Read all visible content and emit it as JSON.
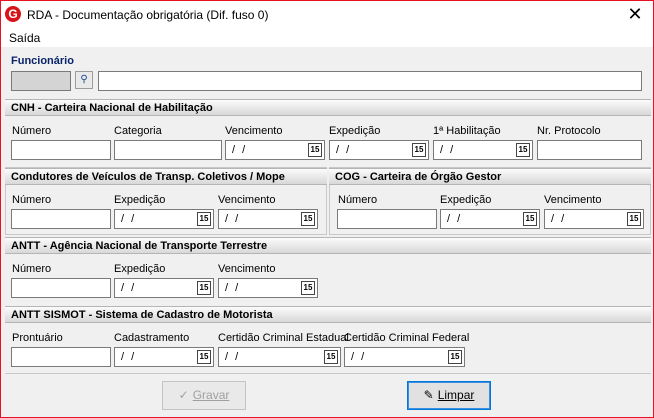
{
  "window": {
    "title": "RDA - Documentação obrigatória (Dif. fuso 0)",
    "app_icon": "G",
    "close": "✕"
  },
  "menu": {
    "items": [
      "Saída"
    ]
  },
  "funcionario": {
    "label": "Funcionário",
    "lookup_icon": "binoculars-icon"
  },
  "cnh": {
    "title": "CNH - Carteira Nacional de Habilitação",
    "labels": [
      "Número",
      "Categoria",
      "Vencimento",
      "Expedição",
      "1ª Habilitação",
      "Nr. Protocolo"
    ],
    "date_placeholder": "/ /"
  },
  "condutores": {
    "title": "Condutores de Veículos de Transp. Coletivos / Mope",
    "labels": [
      "Número",
      "Expedição",
      "Vencimento"
    ]
  },
  "cog": {
    "title": "COG - Carteira de Órgão Gestor",
    "labels": [
      "Número",
      "Expedição",
      "Vencimento"
    ]
  },
  "antt": {
    "title": "ANTT - Agência Nacional de Transporte Terrestre",
    "labels": [
      "Número",
      "Expedição",
      "Vencimento"
    ]
  },
  "sismot": {
    "title": "ANTT SISMOT - Sistema de Cadastro de Motorista",
    "labels": [
      "Prontuário",
      "Cadastramento",
      "Certidão Criminal Estadual",
      "Certidão Criminal Federal"
    ]
  },
  "buttons": {
    "gravar": "Gravar",
    "limpar": "Limpar"
  },
  "calendar_glyph": "15"
}
